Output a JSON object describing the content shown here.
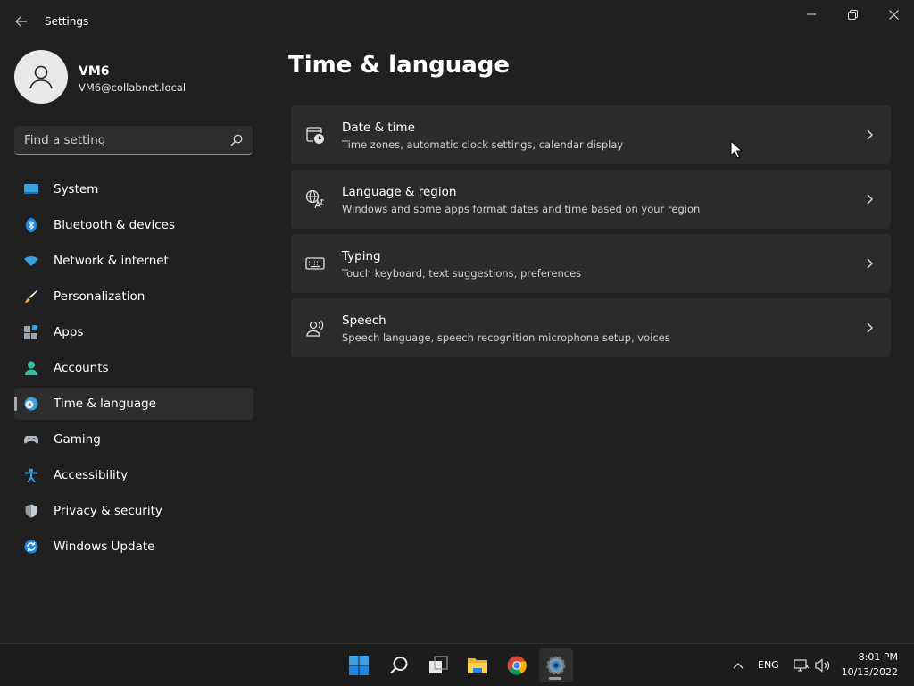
{
  "window": {
    "title": "Settings",
    "controls": {
      "minimize": "minimize-icon",
      "maximize": "restore-icon",
      "close": "close-icon"
    }
  },
  "profile": {
    "name": "VM6",
    "email": "VM6@collabnet.local"
  },
  "search": {
    "placeholder": "Find a setting",
    "icon": "search-icon"
  },
  "sidebar": {
    "items": [
      {
        "label": "System",
        "icon": "system-display-icon",
        "selected": false
      },
      {
        "label": "Bluetooth & devices",
        "icon": "bluetooth-icon",
        "selected": false
      },
      {
        "label": "Network & internet",
        "icon": "wifi-icon",
        "selected": false
      },
      {
        "label": "Personalization",
        "icon": "paintbrush-icon",
        "selected": false
      },
      {
        "label": "Apps",
        "icon": "apps-grid-icon",
        "selected": false
      },
      {
        "label": "Accounts",
        "icon": "person-icon",
        "selected": false
      },
      {
        "label": "Time & language",
        "icon": "clock-globe-icon",
        "selected": true
      },
      {
        "label": "Gaming",
        "icon": "gamepad-icon",
        "selected": false
      },
      {
        "label": "Accessibility",
        "icon": "accessibility-icon",
        "selected": false
      },
      {
        "label": "Privacy & security",
        "icon": "shield-icon",
        "selected": false
      },
      {
        "label": "Windows Update",
        "icon": "update-icon",
        "selected": false
      }
    ]
  },
  "main": {
    "title": "Time & language",
    "cards": [
      {
        "title": "Date & time",
        "description": "Time zones, automatic clock settings, calendar display",
        "icon": "calendar-clock-icon"
      },
      {
        "title": "Language & region",
        "description": "Windows and some apps format dates and time based on your region",
        "icon": "language-icon"
      },
      {
        "title": "Typing",
        "description": "Touch keyboard, text suggestions, preferences",
        "icon": "keyboard-icon"
      },
      {
        "title": "Speech",
        "description": "Speech language, speech recognition microphone setup, voices",
        "icon": "speech-icon"
      }
    ]
  },
  "taskbar": {
    "apps": [
      "start-icon",
      "search-icon",
      "task-view-icon",
      "file-explorer-icon",
      "chrome-icon",
      "settings-gear-icon"
    ],
    "tray": {
      "language": "ENG",
      "time": "8:01 PM",
      "date": "10/13/2022"
    }
  },
  "colors": {
    "background": "#202020",
    "card": "#2b2b2b",
    "selected": "#2d2d2d",
    "accent": "#4cc2ff"
  }
}
